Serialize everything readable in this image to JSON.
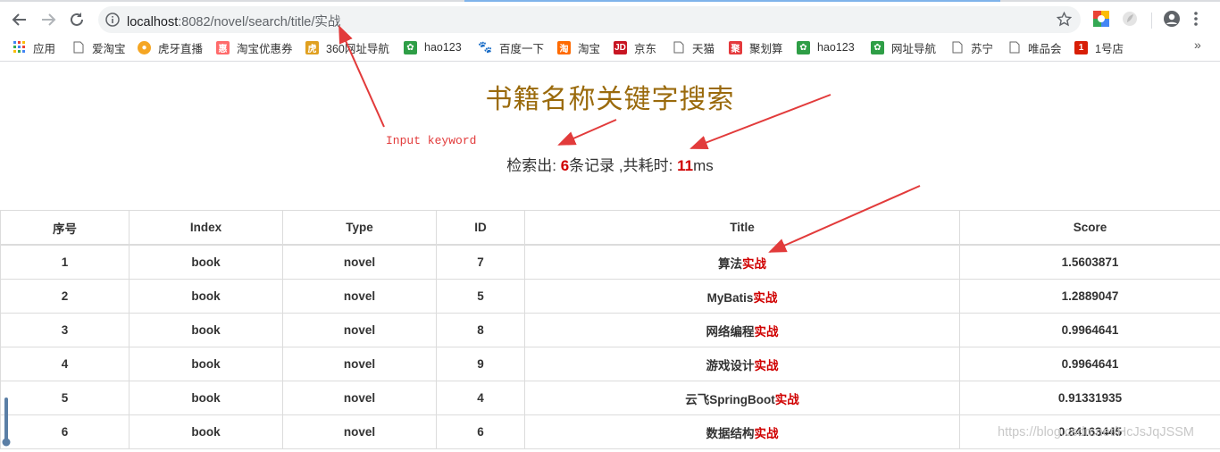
{
  "browser": {
    "url_host": "localhost",
    "url_rest": ":8082/novel/search/title/实战"
  },
  "bookmarks": [
    {
      "label": "应用",
      "icon": "apps-grid-icon",
      "color": "#4285f4"
    },
    {
      "label": "爱淘宝",
      "icon": "page-icon",
      "color": "#666666"
    },
    {
      "label": "虎牙直播",
      "icon": "huya-icon",
      "color": "#f5a623"
    },
    {
      "label": "淘宝优惠券",
      "icon": "coupon-icon",
      "color": "#ff5a5a"
    },
    {
      "label": "360网址导航",
      "icon": "tiger-icon",
      "color": "#e0a020"
    },
    {
      "label": "hao123",
      "icon": "hao123-icon",
      "color": "#2e9e46"
    },
    {
      "label": "百度一下",
      "icon": "baidu-paw-icon",
      "color": "#3385ff"
    },
    {
      "label": "淘宝",
      "icon": "taobao-icon",
      "color": "#ff6a00"
    },
    {
      "label": "京东",
      "icon": "jd-icon",
      "color": "#c81623"
    },
    {
      "label": "天猫",
      "icon": "page-icon",
      "color": "#666666"
    },
    {
      "label": "聚划算",
      "icon": "juhuasuan-icon",
      "color": "#e4393c"
    },
    {
      "label": "hao123",
      "icon": "hao123-icon",
      "color": "#2e9e46"
    },
    {
      "label": "网址导航",
      "icon": "hao123-icon",
      "color": "#2e9e46"
    },
    {
      "label": "苏宁",
      "icon": "page-icon",
      "color": "#666666"
    },
    {
      "label": "唯品会",
      "icon": "page-icon",
      "color": "#666666"
    },
    {
      "label": "1号店",
      "icon": "yhd-icon",
      "color": "#d81e06"
    }
  ],
  "page": {
    "heading": "书籍名称关键字搜索",
    "summary": {
      "prefix": "检索出: ",
      "count": "6",
      "middle": "条记录 ,共耗时: ",
      "time": "11",
      "suffix": "ms"
    }
  },
  "table": {
    "headers": [
      "序号",
      "Index",
      "Type",
      "ID",
      "Title",
      "Score"
    ],
    "keyword": "实战",
    "rows": [
      {
        "no": "1",
        "index": "book",
        "type": "novel",
        "id": "7",
        "title_prefix": "算法",
        "score": "1.5603871"
      },
      {
        "no": "2",
        "index": "book",
        "type": "novel",
        "id": "5",
        "title_prefix": "MyBatis",
        "score": "1.2889047"
      },
      {
        "no": "3",
        "index": "book",
        "type": "novel",
        "id": "8",
        "title_prefix": "网络编程",
        "score": "0.9964641"
      },
      {
        "no": "4",
        "index": "book",
        "type": "novel",
        "id": "9",
        "title_prefix": "游戏设计",
        "score": "0.9964641"
      },
      {
        "no": "5",
        "index": "book",
        "type": "novel",
        "id": "4",
        "title_prefix": "云飞SpringBoot",
        "score": "0.91331935"
      },
      {
        "no": "6",
        "index": "book",
        "type": "novel",
        "id": "6",
        "title_prefix": "数据结构",
        "score": "0.84163445"
      }
    ]
  },
  "annotation": {
    "label": "Input keyword",
    "color": "#e23b3b"
  },
  "watermark": "https://blog.csdn.net/HcJsJqJSSM",
  "colors": {
    "heading": "#9a6a0c",
    "highlight": "#d00000"
  }
}
